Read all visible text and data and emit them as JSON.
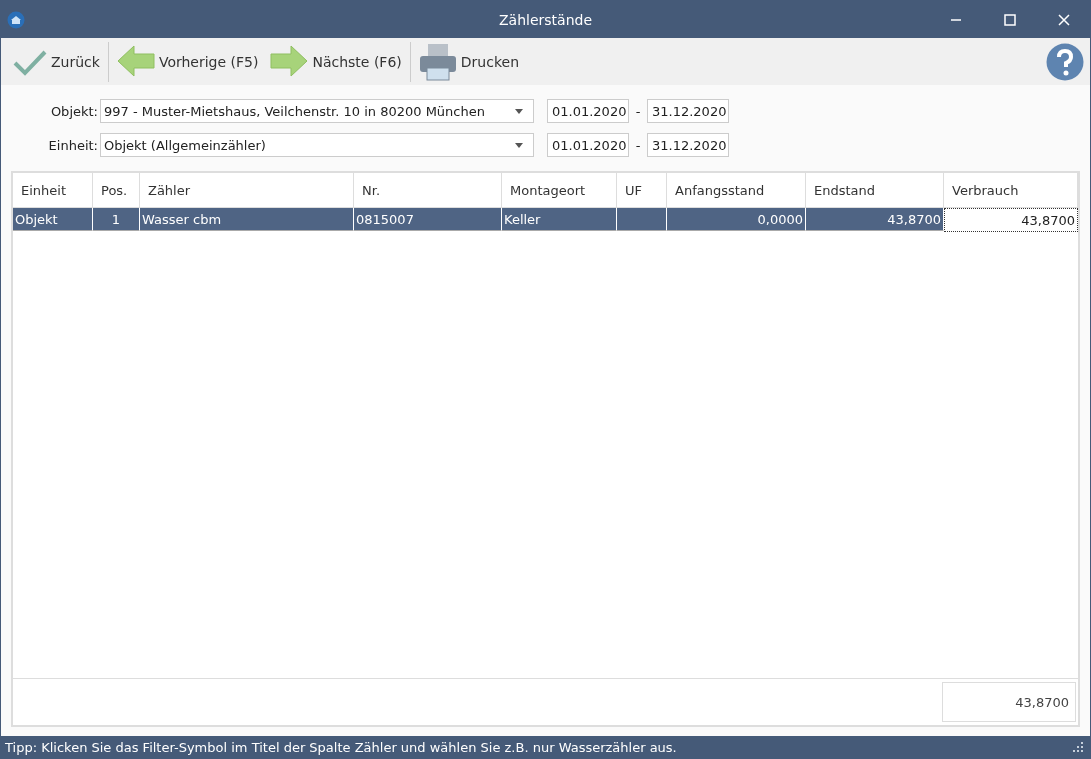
{
  "window": {
    "title": "Zählerstände"
  },
  "toolbar": [
    {
      "label": "Zurück",
      "kind": "check"
    },
    {
      "label": "Vorherige (F5)",
      "kind": "prev"
    },
    {
      "label": "Nächste (F6)",
      "kind": "next"
    },
    {
      "label": "Drucken",
      "kind": "print"
    }
  ],
  "filters": [
    {
      "label": "Objekt:",
      "value": "997 - Muster-Mietshaus, Veilchenstr. 10 in 80200 München",
      "from": "01.01.2020",
      "separator": "-",
      "to": "31.12.2020"
    },
    {
      "label": "Einheit:",
      "value": "Objekt (Allgemeinzähler)",
      "from": "01.01.2020",
      "separator": "-",
      "to": "31.12.2020"
    }
  ],
  "table": {
    "columns": [
      "Einheit",
      "Pos.",
      "Zähler",
      "Nr.",
      "Montageort",
      "UF",
      "Anfangsstand",
      "Endstand",
      "Verbrauch"
    ],
    "rows": [
      {
        "selected": true,
        "cells": [
          {
            "text": "Objekt",
            "focused": false
          },
          {
            "text": "1",
            "focused": false
          },
          {
            "text": "Wasser cbm",
            "focused": false
          },
          {
            "text": "0815007",
            "focused": false
          },
          {
            "text": "Keller",
            "focused": false
          },
          {
            "text": "",
            "focused": false
          },
          {
            "text": "0,0000",
            "focused": false
          },
          {
            "text": "43,8700",
            "focused": false
          },
          {
            "text": "43,8700",
            "focused": true
          }
        ]
      }
    ],
    "total": "43,8700"
  },
  "status_bar": "Tipp: Klicken Sie das Filter-Symbol im Titel der Spalte Zähler und wählen Sie z.B. nur Wasserzähler aus."
}
